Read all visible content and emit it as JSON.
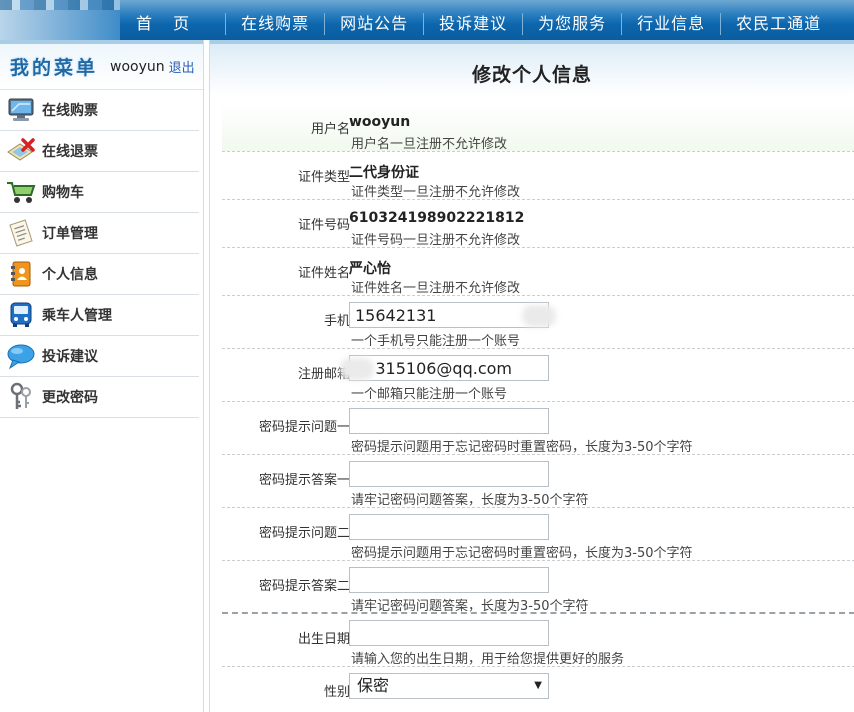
{
  "nav": {
    "items": [
      "首 页",
      "在线购票",
      "网站公告",
      "投诉建议",
      "为您服务",
      "行业信息",
      "农民工通道"
    ]
  },
  "sidebar": {
    "title": "我的菜单",
    "username": "wooyun",
    "logout": "退出",
    "items": [
      {
        "label": "在线购票",
        "icon": "monitor-icon"
      },
      {
        "label": "在线退票",
        "icon": "ticket-cancel-icon"
      },
      {
        "label": "购物车",
        "icon": "shopping-cart-icon"
      },
      {
        "label": "订单管理",
        "icon": "document-icon"
      },
      {
        "label": "个人信息",
        "icon": "contact-book-icon"
      },
      {
        "label": "乘车人管理",
        "icon": "bus-icon"
      },
      {
        "label": "投诉建议",
        "icon": "speech-bubble-icon"
      },
      {
        "label": "更改密码",
        "icon": "keys-icon"
      }
    ]
  },
  "page": {
    "title": "修改个人信息"
  },
  "form": {
    "username": {
      "label": "用户名",
      "value": "wooyun",
      "hint": "用户名一旦注册不允许修改"
    },
    "id_type": {
      "label": "证件类型",
      "value": "二代身份证",
      "hint": "证件类型一旦注册不允许修改"
    },
    "id_number": {
      "label": "证件号码",
      "value": "610324198902221812",
      "hint": "证件号码一旦注册不允许修改"
    },
    "id_name": {
      "label": "证件姓名",
      "value": "严心怡",
      "hint": "证件姓名一旦注册不允许修改"
    },
    "phone": {
      "label": "手机",
      "value": "15642131",
      "hint": "一个手机号只能注册一个账号"
    },
    "email": {
      "label": "注册邮箱",
      "value": "    315106@qq.com",
      "hint": "一个邮箱只能注册一个账号"
    },
    "question1": {
      "label": "密码提示问题一",
      "value": "",
      "hint": "密码提示问题用于忘记密码时重置密码，长度为3-50个字符"
    },
    "answer1": {
      "label": "密码提示答案一",
      "value": "",
      "hint": "请牢记密码问题答案，长度为3-50个字符"
    },
    "question2": {
      "label": "密码提示问题二",
      "value": "",
      "hint": "密码提示问题用于忘记密码时重置密码，长度为3-50个字符"
    },
    "answer2": {
      "label": "密码提示答案二",
      "value": "",
      "hint": "请牢记密码问题答案，长度为3-50个字符"
    },
    "birthday": {
      "label": "出生日期",
      "value": "",
      "hint": "请输入您的出生日期，用于给您提供更好的服务"
    },
    "gender": {
      "label": "性别",
      "value": "保密"
    }
  }
}
